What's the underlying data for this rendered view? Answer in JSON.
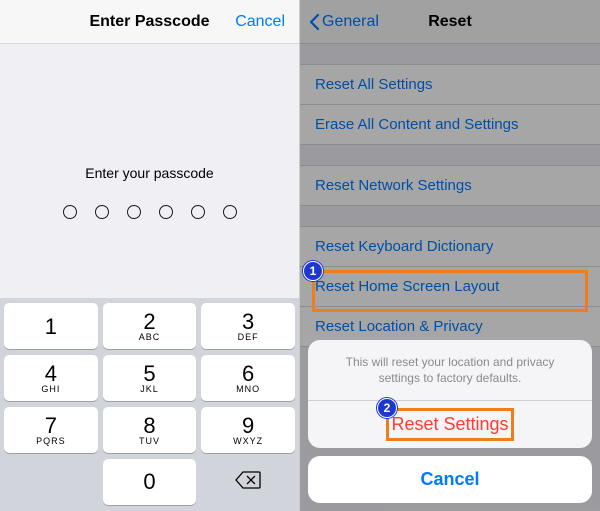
{
  "left": {
    "title": "Enter Passcode",
    "cancel": "Cancel",
    "prompt": "Enter your passcode",
    "keypad": [
      {
        "num": "1",
        "letters": ""
      },
      {
        "num": "2",
        "letters": "ABC"
      },
      {
        "num": "3",
        "letters": "DEF"
      },
      {
        "num": "4",
        "letters": "GHI"
      },
      {
        "num": "5",
        "letters": "JKL"
      },
      {
        "num": "6",
        "letters": "MNO"
      },
      {
        "num": "7",
        "letters": "PQRS"
      },
      {
        "num": "8",
        "letters": "TUV"
      },
      {
        "num": "9",
        "letters": "WXYZ"
      },
      {
        "num": "0",
        "letters": ""
      }
    ]
  },
  "right": {
    "back": "General",
    "title": "Reset",
    "rows": {
      "all": "Reset All Settings",
      "erase": "Erase All Content and Settings",
      "network": "Reset Network Settings",
      "keyboard": "Reset Keyboard Dictionary",
      "home": "Reset Home Screen Layout",
      "location": "Reset Location & Privacy"
    },
    "sheet": {
      "message": "This will reset your location and privacy settings to factory defaults.",
      "action": "Reset Settings",
      "cancel": "Cancel"
    },
    "callouts": {
      "one": "1",
      "two": "2"
    }
  }
}
